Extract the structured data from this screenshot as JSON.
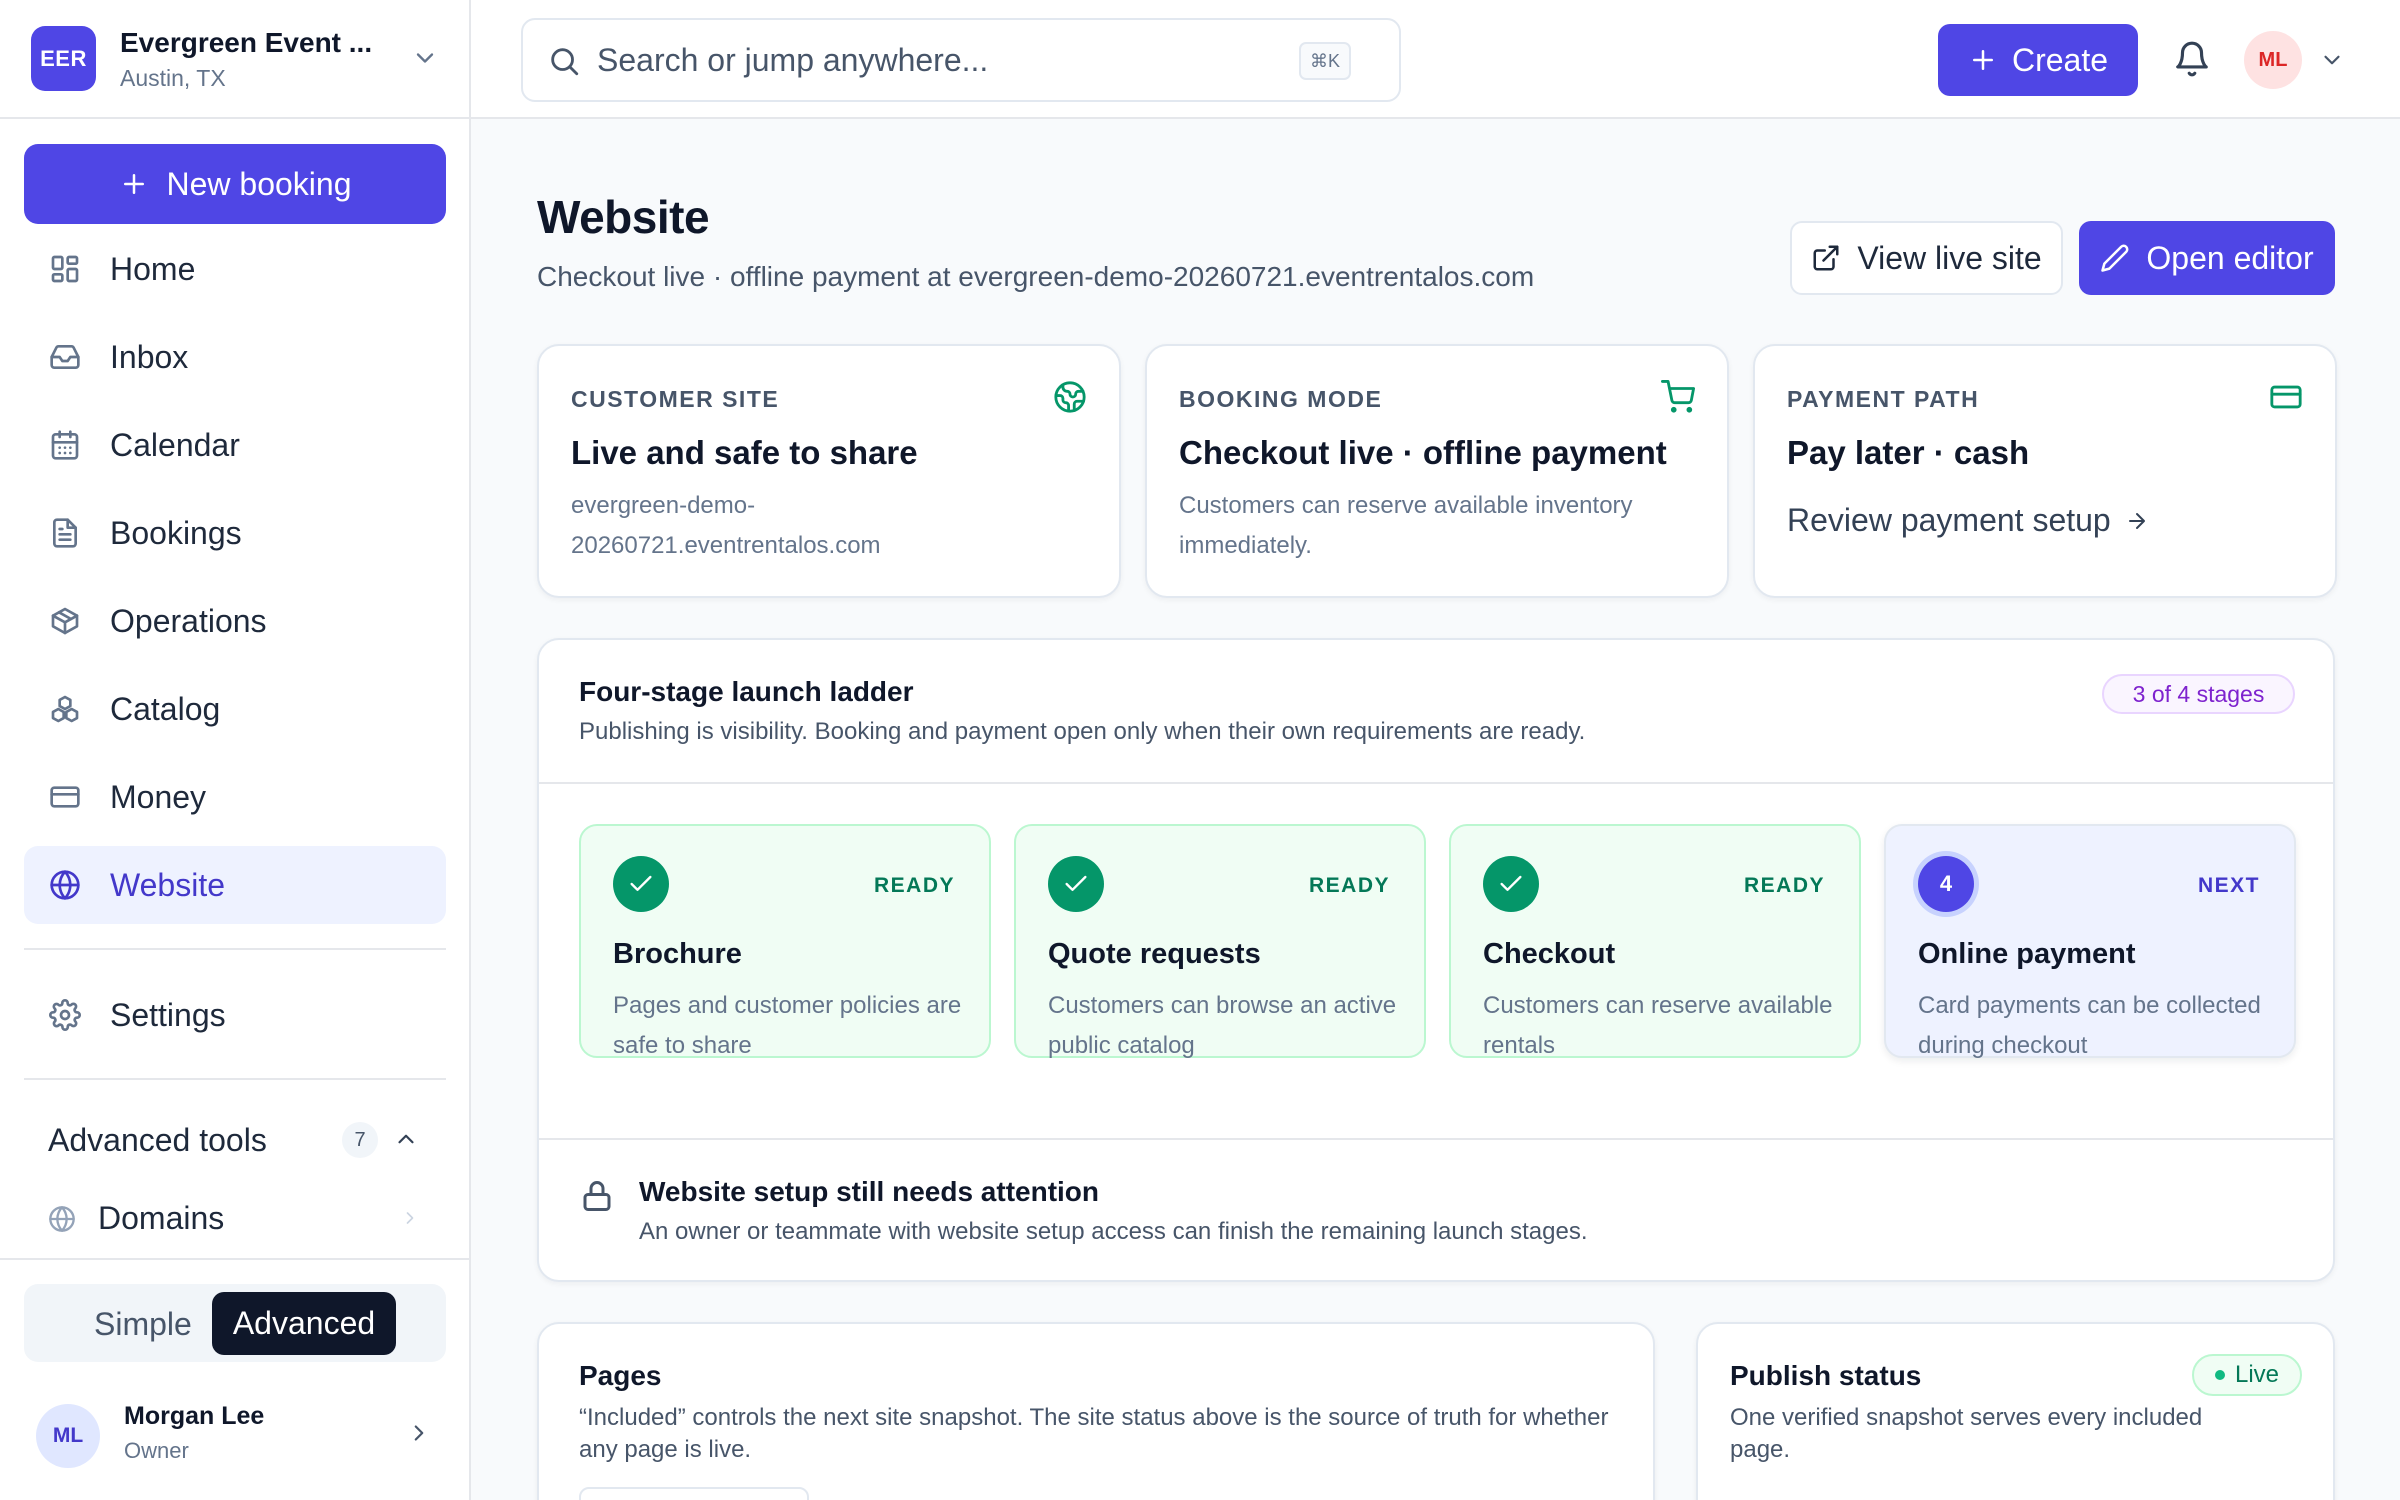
{
  "org": {
    "badge": "EER",
    "name": "Evergreen Event ...",
    "location": "Austin, TX"
  },
  "sidebar": {
    "new_booking": "New booking",
    "items": [
      {
        "label": "Home",
        "icon": "home-grid-icon"
      },
      {
        "label": "Inbox",
        "icon": "inbox-icon"
      },
      {
        "label": "Calendar",
        "icon": "calendar-icon"
      },
      {
        "label": "Bookings",
        "icon": "document-icon"
      },
      {
        "label": "Operations",
        "icon": "box-icon"
      },
      {
        "label": "Catalog",
        "icon": "boxes-icon"
      },
      {
        "label": "Money",
        "icon": "credit-card-icon"
      },
      {
        "label": "Website",
        "icon": "globe-icon",
        "active": true
      }
    ],
    "settings": "Settings",
    "advanced": {
      "title": "Advanced tools",
      "count": "7"
    },
    "domains": "Domains",
    "mode": {
      "simple": "Simple",
      "advanced": "Advanced",
      "selected": "Advanced"
    },
    "user": {
      "initials": "ML",
      "name": "Morgan Lee",
      "role": "Owner"
    }
  },
  "topbar": {
    "search_placeholder": "Search or jump anywhere...",
    "shortcut": "⌘K",
    "create": "Create",
    "avatar": "ML"
  },
  "header": {
    "title": "Website",
    "subtitle": "Checkout live · offline payment at evergreen-demo-20260721.eventrentalos.com",
    "view_live": "View live site",
    "open_editor": "Open editor"
  },
  "summary": [
    {
      "label": "CUSTOMER SITE",
      "title": "Live and safe to share",
      "body": "evergreen-demo-20260721.eventrentalos.com",
      "icon": "globe-icon"
    },
    {
      "label": "BOOKING MODE",
      "title": "Checkout live · offline payment",
      "body": "Customers can reserve available inventory immediately.",
      "icon": "cart-icon"
    },
    {
      "label": "PAYMENT PATH",
      "title": "Pay later · cash",
      "link": "Review payment setup",
      "icon": "credit-card-icon"
    }
  ],
  "ladder": {
    "title": "Four-stage launch ladder",
    "subtitle": "Publishing is visibility. Booking and payment open only when their own requirements are ready.",
    "progress": "3 of 4 stages",
    "stages": [
      {
        "status": "READY",
        "title": "Brochure",
        "body": "Pages and customer policies are safe to share"
      },
      {
        "status": "READY",
        "title": "Quote requests",
        "body": "Customers can browse an active public catalog"
      },
      {
        "status": "READY",
        "title": "Checkout",
        "body": "Customers can reserve available rentals"
      },
      {
        "number": "4",
        "status": "NEXT",
        "title": "Online payment",
        "body": "Card payments can be collected during checkout"
      }
    ],
    "attention_title": "Website setup still needs attention",
    "attention_body": "An owner or teammate with website setup access can finish the remaining launch stages."
  },
  "pages": {
    "title": "Pages",
    "body": "“Included” controls the next site snapshot. The site status above is the source of truth for whether any page is live."
  },
  "publish": {
    "title": "Publish status",
    "body": "One verified snapshot serves every included page.",
    "badge": "Live"
  },
  "colors": {
    "accent": "#4f46e5",
    "success": "#059669",
    "success_bg": "#f0fdf4",
    "next_bg": "#eef2ff"
  }
}
